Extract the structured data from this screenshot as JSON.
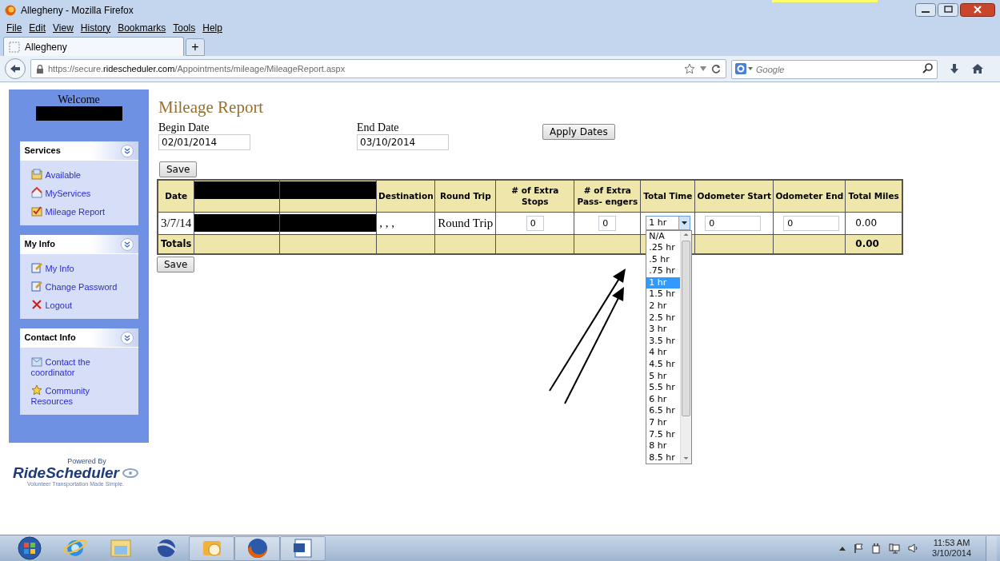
{
  "window": {
    "title": "Allegheny - Mozilla Firefox"
  },
  "menu": [
    "File",
    "Edit",
    "View",
    "History",
    "Bookmarks",
    "Tools",
    "Help"
  ],
  "tabs": [
    {
      "label": "Allegheny",
      "selected": true
    }
  ],
  "new_tab": "+",
  "address": {
    "scheme_host": "https://secure.",
    "domain": "ridescheduler.com",
    "path": "/Appointments/mileage/MileageReport.aspx"
  },
  "search": {
    "placeholder": "Google"
  },
  "sidebar": {
    "welcome": "Welcome",
    "sections": [
      {
        "title": "Services",
        "items": [
          {
            "label": "Available",
            "kind": "calendar"
          },
          {
            "label": "MyServices",
            "kind": "house"
          },
          {
            "label": "Mileage Report",
            "kind": "check"
          }
        ]
      },
      {
        "title": "My Info",
        "items": [
          {
            "label": "My Info",
            "kind": "edit"
          },
          {
            "label": "Change Password",
            "kind": "edit"
          },
          {
            "label": "Logout",
            "kind": "cross"
          }
        ]
      },
      {
        "title": "Contact Info",
        "items": [
          {
            "label": "Contact the coordinator",
            "kind": "envelope"
          },
          {
            "label": "Community Resources",
            "kind": "star"
          }
        ]
      }
    ]
  },
  "logo": {
    "powered_by": "Powered By",
    "name": "RideScheduler",
    "tagline": "Volunteer Transportation Made Simple."
  },
  "report": {
    "title": "Mileage Report",
    "begin_date": {
      "label": "Begin Date",
      "value": "02/01/2014"
    },
    "end_date": {
      "label": "End Date",
      "value": "03/10/2014"
    },
    "apply_button": "Apply Dates",
    "save_buttons": [
      "Save",
      "Save"
    ],
    "table": {
      "columns": [
        {
          "label": "Date"
        },
        {
          "redacted": true
        },
        {
          "redacted": true
        },
        {
          "label": "Destination"
        },
        {
          "label": "Round Trip"
        },
        {
          "label": "# of Extra Stops"
        },
        {
          "label": "# of Extra Pass- engers"
        },
        {
          "label": "Total Time"
        },
        {
          "label": "Odometer Start"
        },
        {
          "label": "Odometer End"
        },
        {
          "label": "Total Miles"
        }
      ],
      "rows": [
        [
          {
            "kind": "text",
            "text": "3/7/14"
          },
          {
            "kind": "redacted"
          },
          {
            "kind": "redacted"
          },
          {
            "kind": "text",
            "text": ", , ,"
          },
          {
            "kind": "text",
            "text": "Round Trip"
          },
          {
            "kind": "input",
            "value": "0"
          },
          {
            "kind": "input",
            "value": "0"
          },
          {
            "kind": "select",
            "value": "1 hr",
            "expanded": true
          },
          {
            "kind": "input",
            "value": "0"
          },
          {
            "kind": "input",
            "value": "0"
          },
          {
            "kind": "number",
            "text": "0.00"
          }
        ]
      ],
      "totals": {
        "label": "Totals",
        "total_miles": "0.00"
      }
    },
    "time_options": [
      {
        "label": "N/A",
        "selected": false
      },
      {
        "label": ".25 hr",
        "selected": false
      },
      {
        "label": ".5 hr",
        "selected": false
      },
      {
        "label": ".75 hr",
        "selected": false
      },
      {
        "label": "1 hr",
        "selected": true
      },
      {
        "label": "1.5 hr",
        "selected": false
      },
      {
        "label": "2 hr",
        "selected": false
      },
      {
        "label": "2.5 hr",
        "selected": false
      },
      {
        "label": "3 hr",
        "selected": false
      },
      {
        "label": "3.5 hr",
        "selected": false
      },
      {
        "label": "4 hr",
        "selected": false
      },
      {
        "label": "4.5 hr",
        "selected": false
      },
      {
        "label": "5 hr",
        "selected": false
      },
      {
        "label": "5.5 hr",
        "selected": false
      },
      {
        "label": "6 hr",
        "selected": false
      },
      {
        "label": "6.5 hr",
        "selected": false
      },
      {
        "label": "7 hr",
        "selected": false
      },
      {
        "label": "7.5 hr",
        "selected": false
      },
      {
        "label": "8 hr",
        "selected": false
      },
      {
        "label": "8.5 hr",
        "selected": false
      }
    ]
  },
  "taskbar": {
    "apps": [
      {
        "kind": "start"
      },
      {
        "kind": "globe"
      },
      {
        "kind": "folder"
      },
      {
        "kind": "sphere"
      },
      {
        "kind": "mail",
        "open": true
      },
      {
        "kind": "fox",
        "open": true
      },
      {
        "kind": "document",
        "open": true
      }
    ],
    "clock": {
      "time": "11:53 AM",
      "date": "3/10/2014"
    }
  }
}
